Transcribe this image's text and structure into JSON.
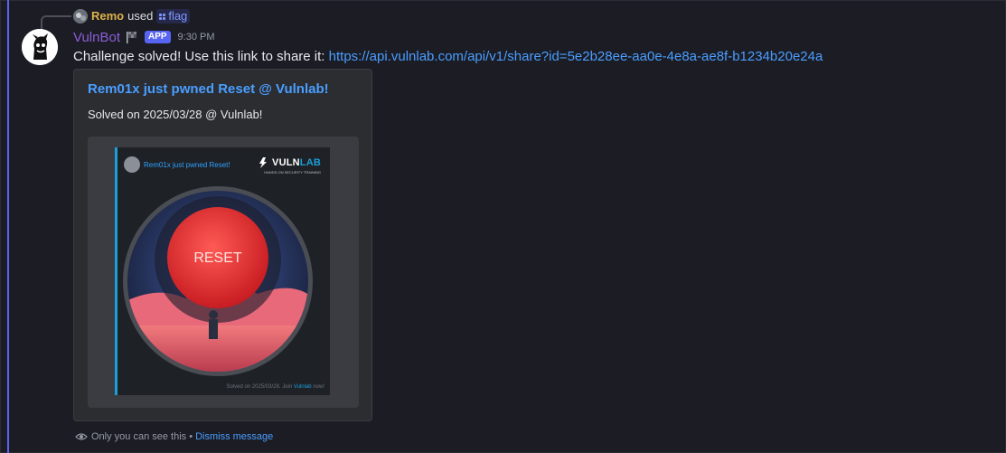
{
  "reply": {
    "user": "Remo",
    "used_text": "used",
    "command": "flag"
  },
  "message": {
    "author": "VulnBot",
    "badge": "APP",
    "timestamp": "9:30 PM",
    "text": "Challenge solved! Use this link to share it:",
    "link": "https://api.vulnlab.com/api/v1/share?id=5e2b28ee-aa0e-4e8a-ae8f-b1234b20e24a"
  },
  "embed": {
    "title": "Rem01x just pwned Reset @ Vulnlab!",
    "description": "Solved on 2025/03/28 @ Vulnlab!",
    "image": {
      "card_title": "Rem01x just pwned Reset!",
      "logo_part1": "VULN",
      "logo_part2": "LAB",
      "logo_tagline": "HANDS-ON SECURITY TRAINING",
      "reset_label": "RESET",
      "footer_text": "Solved on 2025/03/28. Join",
      "footer_link": "Vulnlab",
      "footer_end": "now!"
    }
  },
  "footer": {
    "visibility_text": "Only you can see this •",
    "dismiss": "Dismiss message"
  },
  "colors": {
    "accent": "#5865f2",
    "link": "#4a9eff",
    "reply_user": "#e0b24a",
    "bot_name": "#8b5fd7",
    "reset_red": "#e83b3b"
  }
}
